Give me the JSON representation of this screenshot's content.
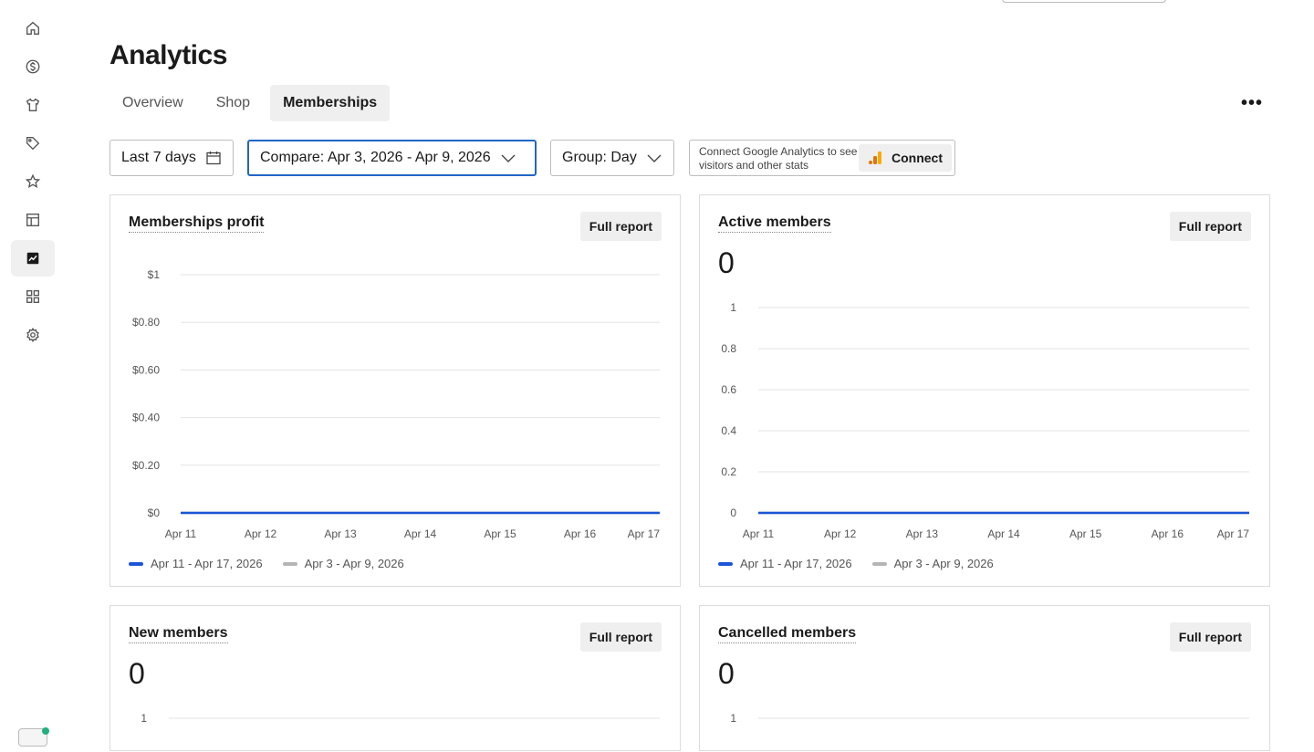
{
  "page": {
    "title": "Analytics"
  },
  "tabs": [
    {
      "label": "Overview",
      "active": false
    },
    {
      "label": "Shop",
      "active": false
    },
    {
      "label": "Memberships",
      "active": true
    }
  ],
  "more_label": "•••",
  "filters": {
    "range": "Last 7 days",
    "compare": "Compare: Apr 3, 2026 - Apr 9, 2026",
    "group": "Group: Day"
  },
  "google_analytics": {
    "text": "Connect Google Analytics to see visitors and other stats",
    "button": "Connect"
  },
  "sidebar": {
    "items": [
      {
        "icon": "home-icon"
      },
      {
        "icon": "dollar-icon"
      },
      {
        "icon": "shirt-icon"
      },
      {
        "icon": "tag-icon"
      },
      {
        "icon": "star-icon"
      },
      {
        "icon": "table-icon"
      },
      {
        "icon": "analytics-icon",
        "active": true
      },
      {
        "icon": "apps-icon"
      },
      {
        "icon": "gear-icon"
      }
    ]
  },
  "colors": {
    "current_series": "#1a56d6",
    "compare_series": "#b5b5b5",
    "accent": "#2166c5"
  },
  "cards": {
    "profit": {
      "title": "Memberships profit",
      "button": "Full report"
    },
    "active": {
      "title": "Active members",
      "value": "0",
      "button": "Full report"
    },
    "new": {
      "title": "New members",
      "value": "0",
      "button": "Full report"
    },
    "cancelled": {
      "title": "Cancelled members",
      "value": "0",
      "button": "Full report"
    }
  },
  "legend": {
    "current": "Apr 11 - Apr 17, 2026",
    "compare": "Apr 3 - Apr 9, 2026"
  },
  "chart_data": [
    {
      "type": "line",
      "title": "Memberships profit",
      "x": [
        "Apr 11",
        "Apr 12",
        "Apr 13",
        "Apr 14",
        "Apr 15",
        "Apr 16",
        "Apr 17"
      ],
      "yticks": [
        "$1",
        "$0.80",
        "$0.60",
        "$0.40",
        "$0.20",
        "$0"
      ],
      "ylim": [
        0,
        1
      ],
      "series": [
        {
          "name": "Apr 11 - Apr 17, 2026",
          "values": [
            0,
            0,
            0,
            0,
            0,
            0,
            0
          ]
        },
        {
          "name": "Apr 3 - Apr 9, 2026",
          "values": [
            0,
            0,
            0,
            0,
            0,
            0,
            0
          ]
        }
      ],
      "grid": true,
      "legend": "bottom-left"
    },
    {
      "type": "line",
      "title": "Active members",
      "x": [
        "Apr 11",
        "Apr 12",
        "Apr 13",
        "Apr 14",
        "Apr 15",
        "Apr 16",
        "Apr 17"
      ],
      "yticks": [
        "1",
        "0.8",
        "0.6",
        "0.4",
        "0.2",
        "0"
      ],
      "ylim": [
        0,
        1
      ],
      "series": [
        {
          "name": "Apr 11 - Apr 17, 2026",
          "values": [
            0,
            0,
            0,
            0,
            0,
            0,
            0
          ]
        },
        {
          "name": "Apr 3 - Apr 9, 2026",
          "values": [
            0,
            0,
            0,
            0,
            0,
            0,
            0
          ]
        }
      ],
      "grid": true,
      "legend": "bottom-left"
    },
    {
      "type": "line",
      "title": "New members",
      "yticks": [
        "1"
      ],
      "ylim": [
        0,
        1
      ]
    },
    {
      "type": "line",
      "title": "Cancelled members",
      "yticks": [
        "1"
      ],
      "ylim": [
        0,
        1
      ]
    }
  ]
}
